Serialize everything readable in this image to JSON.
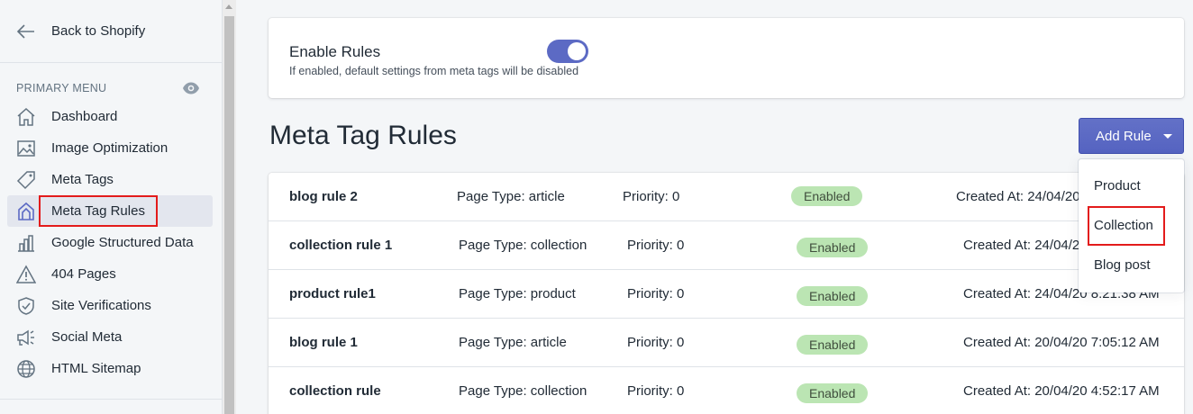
{
  "sidebar": {
    "back_label": "Back to Shopify",
    "menu_heading": "PRIMARY MENU",
    "items": [
      {
        "label": "Dashboard",
        "icon": "home-icon"
      },
      {
        "label": "Image Optimization",
        "icon": "image-icon"
      },
      {
        "label": "Meta Tags",
        "icon": "tag-icon"
      },
      {
        "label": "Meta Tag Rules",
        "icon": "rules-icon",
        "active": true
      },
      {
        "label": "Google Structured Data",
        "icon": "bar-chart-icon"
      },
      {
        "label": "404 Pages",
        "icon": "warning-icon"
      },
      {
        "label": "Site Verifications",
        "icon": "shield-check-icon"
      },
      {
        "label": "Social Meta",
        "icon": "social-icon"
      },
      {
        "label": "HTML Sitemap",
        "icon": "globe-icon"
      }
    ]
  },
  "settings": {
    "enable_title": "Enable Rules",
    "enable_sub": "If enabled, default settings from meta tags will be disabled",
    "enabled": true
  },
  "main": {
    "title": "Meta Tag Rules",
    "add_label": "Add Rule"
  },
  "dropdown": {
    "items": [
      "Product",
      "Collection",
      "Blog post"
    ],
    "highlighted": "Collection"
  },
  "rules": [
    {
      "name": "blog rule 2",
      "page_type": "Page Type: article",
      "priority": "Priority: 0",
      "status": "Enabled",
      "created": "Created At: 24/04/20"
    },
    {
      "name": "collection rule 1",
      "page_type": "Page Type: collection",
      "priority": "Priority: 0",
      "status": "Enabled",
      "created": "Created At: 24/04/2"
    },
    {
      "name": "product rule1",
      "page_type": "Page Type: product",
      "priority": "Priority: 0",
      "status": "Enabled",
      "created": "Created At: 24/04/20 8:21:38 AM"
    },
    {
      "name": "blog rule 1",
      "page_type": "Page Type: article",
      "priority": "Priority: 0",
      "status": "Enabled",
      "created": "Created At: 20/04/20 7:05:12 AM"
    },
    {
      "name": "collection rule",
      "page_type": "Page Type: collection",
      "priority": "Priority: 0",
      "status": "Enabled",
      "created": "Created At: 20/04/20 4:52:17 AM"
    }
  ],
  "colors": {
    "accent": "#5c6ac4",
    "badge_bg": "#bbe5b3",
    "highlight_border": "#e31b1b"
  }
}
